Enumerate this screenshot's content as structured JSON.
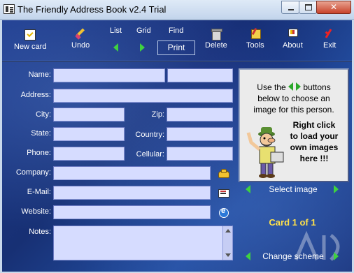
{
  "window": {
    "title": "The Friendly Address Book v2.4 Trial",
    "close_glyph": "✕"
  },
  "toolbar": {
    "new_card": "New card",
    "undo": "Undo",
    "list": "List",
    "grid": "Grid",
    "find": "Find",
    "print": "Print",
    "delete": "Delete",
    "tools": "Tools",
    "about": "About",
    "exit": "Exit"
  },
  "form": {
    "name_label": "Name:",
    "address_label": "Address:",
    "city_label": "City:",
    "zip_label": "Zip:",
    "state_label": "State:",
    "country_label": "Country:",
    "phone_label": "Phone:",
    "cellular_label": "Cellular:",
    "company_label": "Company:",
    "email_label": "E-Mail:",
    "website_label": "Website:",
    "notes_label": "Notes:"
  },
  "image_panel": {
    "line1_before": "Use the",
    "line1_after": "buttons",
    "line2": "below to choose an",
    "line3": "image for this person.",
    "bold1": "Right click",
    "bold2": "to load your",
    "bold3": "own images",
    "bold4": "here !!!"
  },
  "select_image_label": "Select image",
  "card_status": "Card 1 of 1",
  "change_scheme_label": "Change scheme",
  "colors": {
    "background_blue": "#1d3a8c",
    "field_fill": "#d6dcff",
    "card_text": "#ffe14a",
    "arrow_green": "#3fd23f"
  }
}
